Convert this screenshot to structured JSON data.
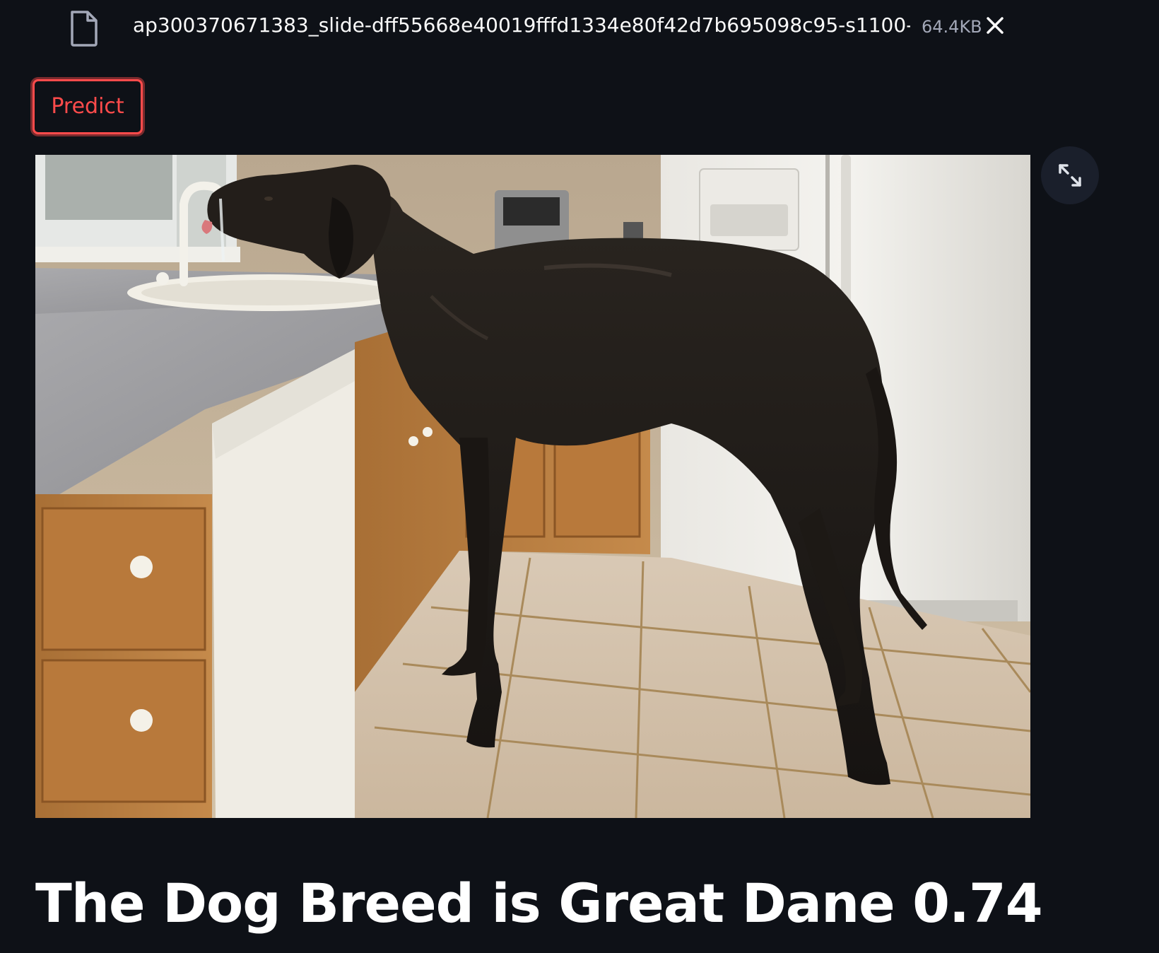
{
  "file": {
    "name": "ap300370671383_slide-dff55668e40019fffd1334e80f42d7b695098c95-s1100-c50.…",
    "size": "64.4KB",
    "icon": "file-icon",
    "close_icon": "close-icon"
  },
  "actions": {
    "predict_label": "Predict"
  },
  "image": {
    "subject": "black Great Dane drinking from kitchen faucet",
    "fullscreen_icon": "fullscreen-icon"
  },
  "result": {
    "heading": "The Dog Breed is Great Dane 0.74"
  },
  "colors": {
    "background": "#0e1117",
    "accent": "#ff4b4b",
    "text": "#fafafa",
    "muted": "#a3a8b8"
  }
}
